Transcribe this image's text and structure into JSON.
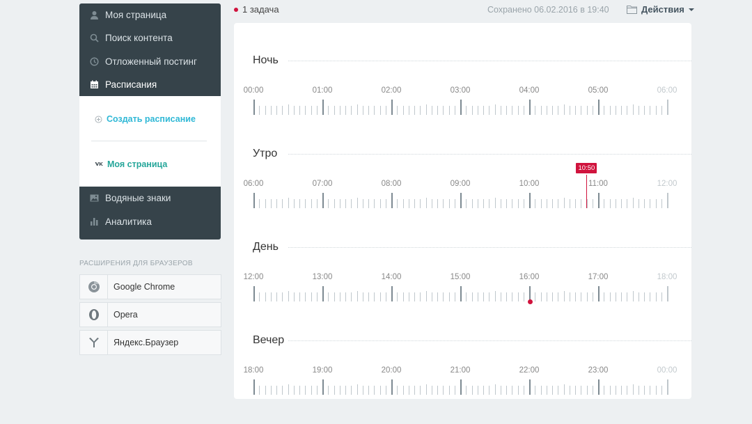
{
  "sidebar": {
    "nav_top": [
      {
        "label": "Моя страница",
        "icon": "user-icon"
      },
      {
        "label": "Поиск контента",
        "icon": "search-icon"
      },
      {
        "label": "Отложенный постинг",
        "icon": "clock-icon"
      },
      {
        "label": "Расписания",
        "icon": "calendar-icon"
      }
    ],
    "sub_items": [
      {
        "label": "Создать расписание",
        "icon": "plus-circle-icon",
        "color": "#2fb8d6"
      },
      {
        "label": "Моя страница",
        "icon": "vk-icon",
        "color": "#26a69a"
      }
    ],
    "nav_bottom": [
      {
        "label": "Водяные знаки",
        "icon": "image-icon"
      },
      {
        "label": "Аналитика",
        "icon": "bar-chart-icon"
      }
    ]
  },
  "extensions": {
    "heading": "РАСШИРЕНИЯ ДЛЯ БРАУЗЕРОВ",
    "items": [
      {
        "label": "Google Chrome",
        "icon": "chrome-icon"
      },
      {
        "label": "Opera",
        "icon": "opera-icon"
      },
      {
        "label": "Яндекс.Браузер",
        "icon": "yandex-browser-icon"
      }
    ]
  },
  "topbar": {
    "task_count": "1 задача",
    "saved": "Сохранено 06.02.2016 в 19:40",
    "actions": "Действия"
  },
  "schedule": {
    "sections": [
      {
        "title": "Ночь",
        "hours": [
          "00:00",
          "01:00",
          "02:00",
          "03:00",
          "04:00",
          "05:00",
          "06:00"
        ]
      },
      {
        "title": "Утро",
        "hours": [
          "06:00",
          "07:00",
          "08:00",
          "09:00",
          "10:00",
          "11:00",
          "12:00"
        ]
      },
      {
        "title": "День",
        "hours": [
          "12:00",
          "13:00",
          "14:00",
          "15:00",
          "16:00",
          "17:00",
          "18:00"
        ]
      },
      {
        "title": "Вечер",
        "hours": [
          "18:00",
          "19:00",
          "20:00",
          "21:00",
          "22:00",
          "23:00",
          "00:00"
        ]
      }
    ],
    "marker": {
      "section": 1,
      "time": "10:50",
      "hours_from_start": 4.8333
    },
    "scheduled_dot": {
      "section": 2,
      "hours_from_start": 4
    },
    "colors": {
      "accent": "#d0133d",
      "sidebar": "#36434a",
      "link": "#2fb8d6"
    }
  }
}
